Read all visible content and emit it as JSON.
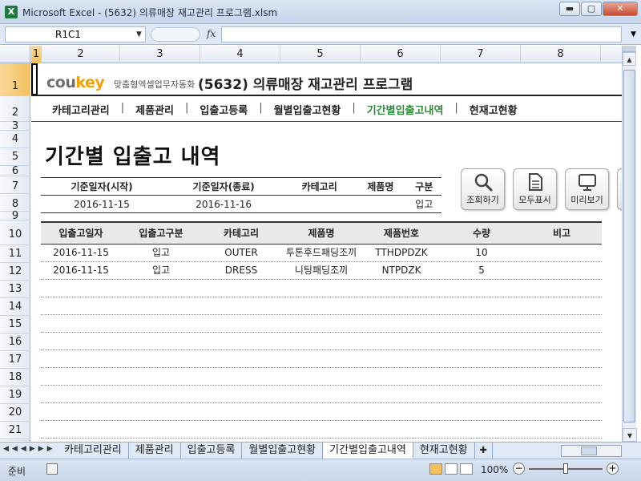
{
  "window": {
    "title": "Microsoft Excel - (5632) 의류매장 재고관리 프로그램.xlsm",
    "app_icon": "X",
    "min_label": "▬",
    "max_label": "▢",
    "close_label": "✕"
  },
  "formula_bar": {
    "name_box": "R1C1",
    "fx": "fx",
    "formula": ""
  },
  "columns": [
    "1",
    "2",
    "3",
    "4",
    "5",
    "6",
    "7",
    "8"
  ],
  "rows": [
    "1",
    "2",
    "3",
    "4",
    "5",
    "6",
    "7",
    "8",
    "9",
    "10",
    "11",
    "12",
    "13",
    "14",
    "15",
    "16",
    "17",
    "18",
    "19",
    "20",
    "21"
  ],
  "header": {
    "logo_main": "cou",
    "logo_accent": "key",
    "logo_tag": "맞춤형엑셀업무자동화",
    "program_title": "(5632) 의류매장 재고관리 프로그램"
  },
  "nav": {
    "items": [
      "카테고리관리",
      "제품관리",
      "입출고등록",
      "월별입출고현황",
      "기간별입출고내역",
      "현재고현황"
    ],
    "current": "기간별입출고내역"
  },
  "page_title": "기간별 입출고 내역",
  "filter": {
    "headers": [
      "기준일자(시작)",
      "기준일자(종료)",
      "카테고리",
      "제품명",
      "구분"
    ],
    "values": [
      "2016-11-15",
      "2016-11-16",
      "",
      "",
      "입고"
    ]
  },
  "actions": [
    {
      "label": "조회하기",
      "icon": "magnifier-icon"
    },
    {
      "label": "모두표시",
      "icon": "document-icon"
    },
    {
      "label": "미리보기",
      "icon": "monitor-icon"
    }
  ],
  "table": {
    "headers": [
      "입출고일자",
      "입출고구분",
      "카테고리",
      "제품명",
      "제품번호",
      "수량",
      "비고"
    ],
    "rows": [
      [
        "2016-11-15",
        "입고",
        "OUTER",
        "투톤후드패딩조끼",
        "TTHDPDZK",
        "10",
        ""
      ],
      [
        "2016-11-15",
        "입고",
        "DRESS",
        "니팅패딩조끼",
        "NTPDZK",
        "5",
        ""
      ]
    ]
  },
  "sheet_tabs": [
    "카테고리관리",
    "제품관리",
    "입출고등록",
    "월별입출고현황",
    "기간별입출고내역",
    "현재고현황"
  ],
  "active_tab": "기간별입출고내역",
  "status": {
    "ready": "준비",
    "zoom": "100%"
  }
}
